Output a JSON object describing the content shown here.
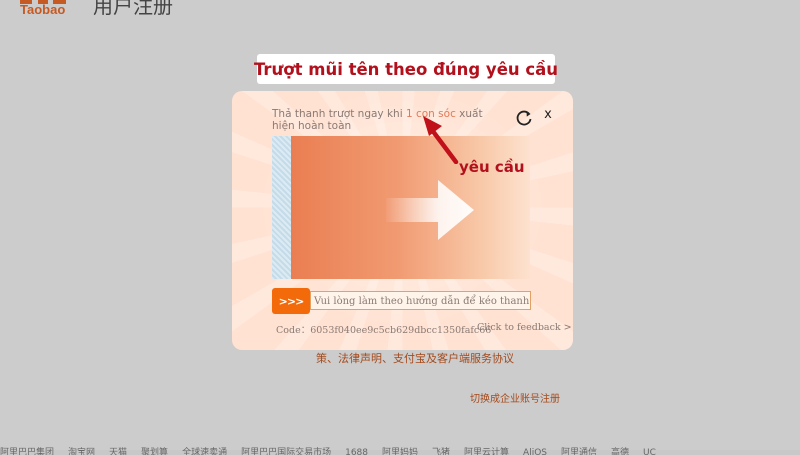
{
  "background": {
    "logo_text": "Taobao",
    "header_title": "用户注册",
    "links_text": "策、法律声明、支付宝及客户端服务协议",
    "switch_text": "切换成企业账号注册",
    "footer_items": [
      "阿里巴巴集团",
      "淘宝网",
      "天猫",
      "聚划算",
      "全球速卖通",
      "阿里巴巴国际交易市场",
      "1688",
      "阿里妈妈",
      "飞猪",
      "阿里云计算",
      "AliOS",
      "阿里通信",
      "高德",
      "UC"
    ]
  },
  "banner": {
    "text": "Trượt mũi tên theo đúng yêu cầu"
  },
  "captcha": {
    "instruction_before": "Thả thanh trượt ngay khi ",
    "instruction_highlight": "1 con sóc",
    "instruction_after": " xuất hiện hoàn toàn",
    "close_label": "x",
    "slider_placeholder": "Vui lòng làm theo hướng dẫn để kéo thanh trư",
    "handle_label": ">>>",
    "code_label": "Code：6053f040ee9c5cb629dbcc1350fafc66",
    "feedback_label": "Click to feedback >"
  },
  "annotation": {
    "label": "yêu cầu"
  },
  "colors": {
    "banner_text": "#b2101c",
    "handle": "#f26a0a",
    "modal_bg": "#ffe2d2",
    "annotation": "#b2101c"
  }
}
